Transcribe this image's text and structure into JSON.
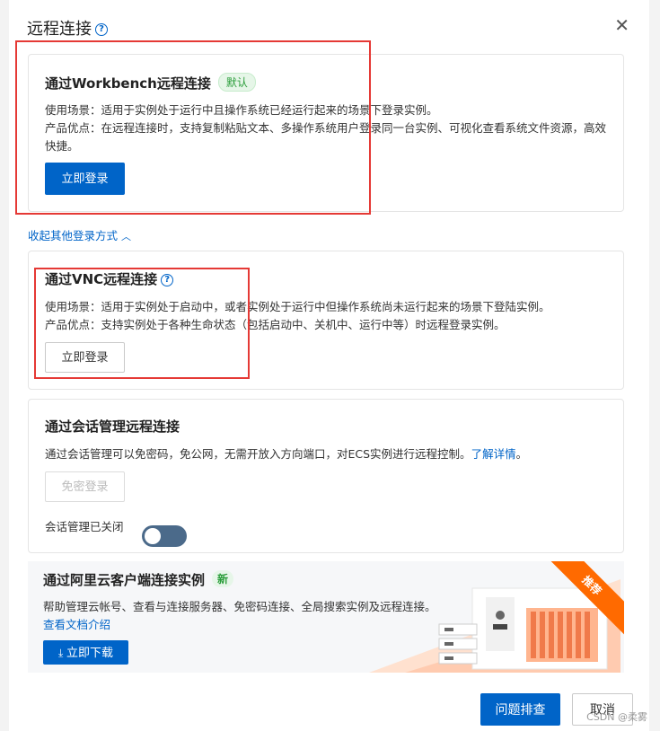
{
  "dialog": {
    "title": "远程连接",
    "close_icon": "close-icon"
  },
  "workbench": {
    "title": "通过Workbench远程连接",
    "tag": "默认",
    "scenario": "使用场景：适用于实例处于运行中且操作系统已经运行起来的场景下登录实例。",
    "advantage": "产品优点：在远程连接时，支持复制粘贴文本、多操作系统用户登录同一台实例、可视化查看系统文件资源，高效快捷。",
    "button": "立即登录"
  },
  "collapse_link": "收起其他登录方式",
  "vnc": {
    "title": "通过VNC远程连接",
    "scenario": "使用场景：适用于实例处于启动中，或者实例处于运行中但操作系统尚未运行起来的场景下登陆实例。",
    "advantage": "产品优点：支持实例处于各种生命状态（包括启动中、关机中、运行中等）时远程登录实例。",
    "button": "立即登录"
  },
  "session": {
    "title": "通过会话管理远程连接",
    "desc": "通过会话管理可以免密码，免公网，无需开放入方向端口，对ECS实例进行远程控制。",
    "learn_more": "了解详情",
    "period": "。",
    "button": "免密登录",
    "toggle_label": "会话管理已关闭",
    "toggle_on": false
  },
  "client": {
    "title": "通过阿里云客户端连接实例",
    "tag": "新",
    "desc": "帮助管理云帐号、查看与连接服务器、免密码连接、全局搜索实例及远程连接。",
    "doc_link": "查看文档介绍",
    "download": "立即下载",
    "ribbon": "推荐"
  },
  "footer": {
    "troubleshoot": "问题排查",
    "cancel": "取消"
  },
  "watermark": "CSDN @柔雾",
  "colors": {
    "primary": "#0064c8",
    "annotation_red": "#e53935",
    "ribbon": "#ff6a00"
  }
}
